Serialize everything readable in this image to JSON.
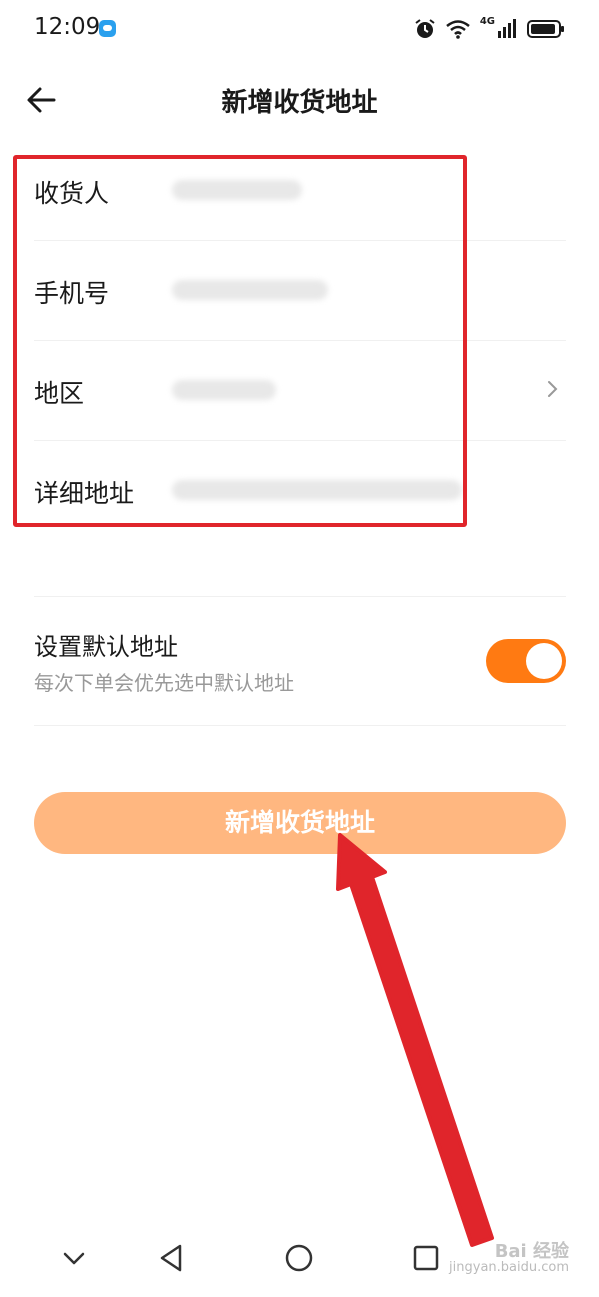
{
  "status_bar": {
    "time": "12:09",
    "network": "4G"
  },
  "header": {
    "title": "新增收货地址"
  },
  "form": {
    "fields": [
      {
        "label": "收货人"
      },
      {
        "label": "手机号"
      },
      {
        "label": "地区"
      },
      {
        "label": "详细地址"
      }
    ]
  },
  "default_address": {
    "title": "设置默认地址",
    "subtitle": "每次下单会优先选中默认地址",
    "enabled": true
  },
  "submit_button": {
    "label": "新增收货地址"
  },
  "watermark": {
    "line1": "Bai 经验",
    "line2": "jingyan.baidu.com"
  },
  "colors": {
    "accent": "#ff7a12",
    "button": "#ffb780",
    "annotation": "#e0252b"
  }
}
